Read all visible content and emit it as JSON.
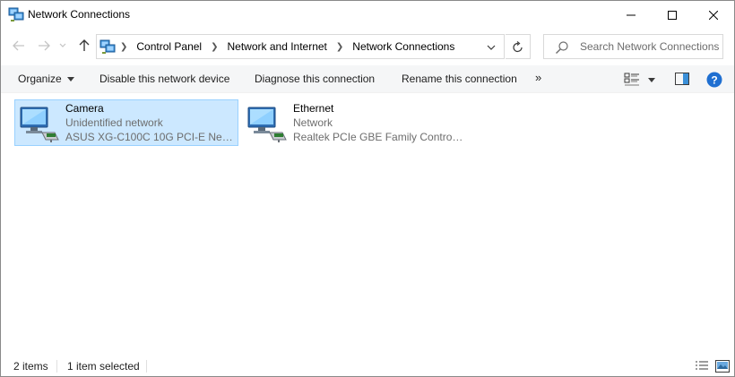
{
  "window": {
    "title": "Network Connections",
    "controls": [
      "minimize-icon",
      "maximize-icon",
      "close-icon"
    ]
  },
  "address": {
    "breadcrumb": [
      "Control Panel",
      "Network and Internet",
      "Network Connections"
    ],
    "search_placeholder": "Search Network Connections"
  },
  "toolbar": {
    "organize": "Organize",
    "disable": "Disable this network device",
    "diagnose": "Diagnose this connection",
    "rename": "Rename this connection",
    "more": "»"
  },
  "connections": [
    {
      "name": "Camera",
      "status": "Unidentified network",
      "device": "ASUS XG-C100C 10G PCI-E Netwo...",
      "selected": true
    },
    {
      "name": "Ethernet",
      "status": "Network",
      "device": "Realtek PCIe GBE Family Controller",
      "selected": false
    }
  ],
  "statusbar": {
    "item_count": "2 items",
    "selection": "1 item selected"
  },
  "colors": {
    "selection_bg": "#cce8ff",
    "selection_border": "#99d1ff",
    "help_blue": "#1f6fd1",
    "toolbar_bg": "#f5f6f7"
  }
}
